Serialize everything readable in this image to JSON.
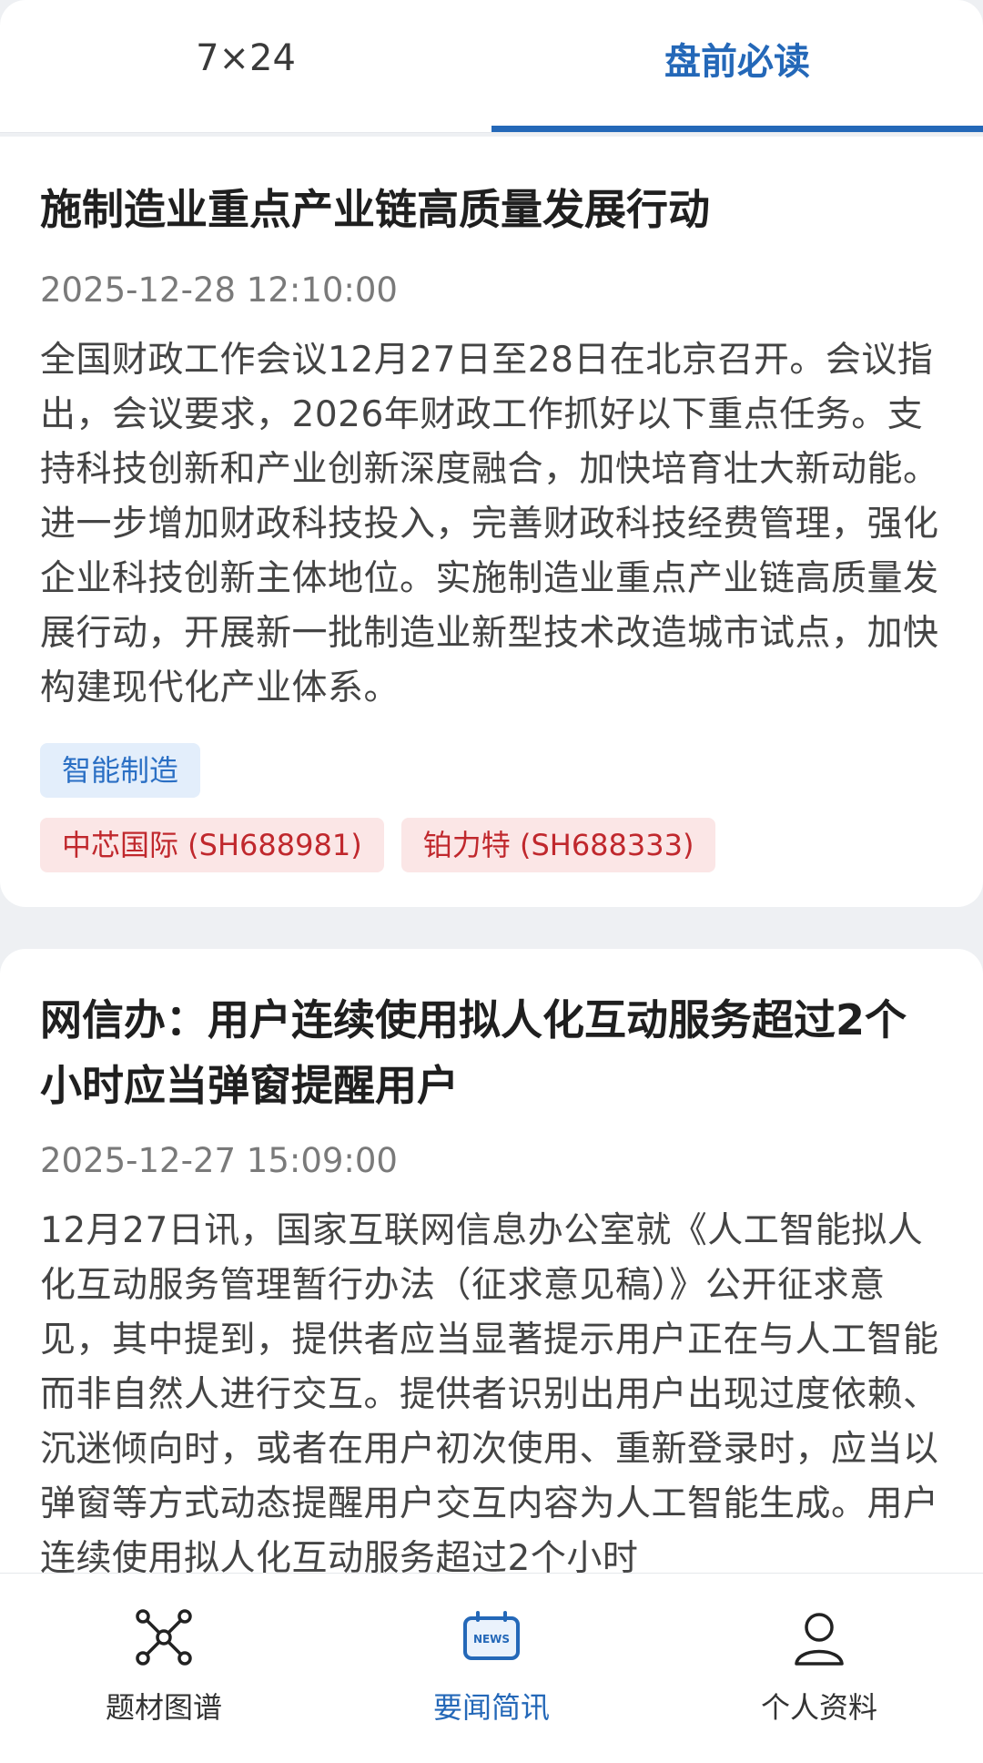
{
  "tabs": {
    "left": "7×24",
    "right": "盘前必读"
  },
  "articles": [
    {
      "title": "施制造业重点产业链高质量发展行动",
      "time": "2025-12-28 12:10:00",
      "body": "全国财政工作会议12月27日至28日在北京召开。会议指出，会议要求，2026年财政工作抓好以下重点任务。支持科技创新和产业创新深度融合，加快培育壮大新动能。进一步增加财政科技投入，完善财政科技经费管理，强化企业科技创新主体地位。实施制造业重点产业链高质量发展行动，开展新一批制造业新型技术改造城市试点，加快构建现代化产业体系。",
      "topic_tag": "智能制造",
      "stock_tags": [
        "中芯国际 (SH688981)",
        "铂力特 (SH688333)"
      ]
    },
    {
      "title": "网信办：用户连续使用拟人化互动服务超过2个小时应当弹窗提醒用户",
      "time": "2025-12-27 15:09:00",
      "body": "12月27日讯，国家互联网信息办公室就《人工智能拟人化互动服务管理暂行办法（征求意见稿）》公开征求意见，其中提到，提供者应当显著提示用户正在与人工智能而非自然人进行交互。提供者识别出用户出现过度依赖、沉迷倾向时，或者在用户初次使用、重新登录时，应当以弹窗等方式动态提醒用户交互内容为人工智能生成。用户连续使用拟人化互动服务超过2个小时"
    }
  ],
  "bottom_nav": [
    {
      "label": "题材图谱",
      "icon": "graph-network-icon"
    },
    {
      "label": "要闻简讯",
      "icon": "news-icon",
      "active": true
    },
    {
      "label": "个人资料",
      "icon": "user-icon"
    }
  ],
  "colors": {
    "accent": "#2468b8",
    "stock_red": "#c0282d",
    "topic_blue": "#2a6fc4"
  }
}
